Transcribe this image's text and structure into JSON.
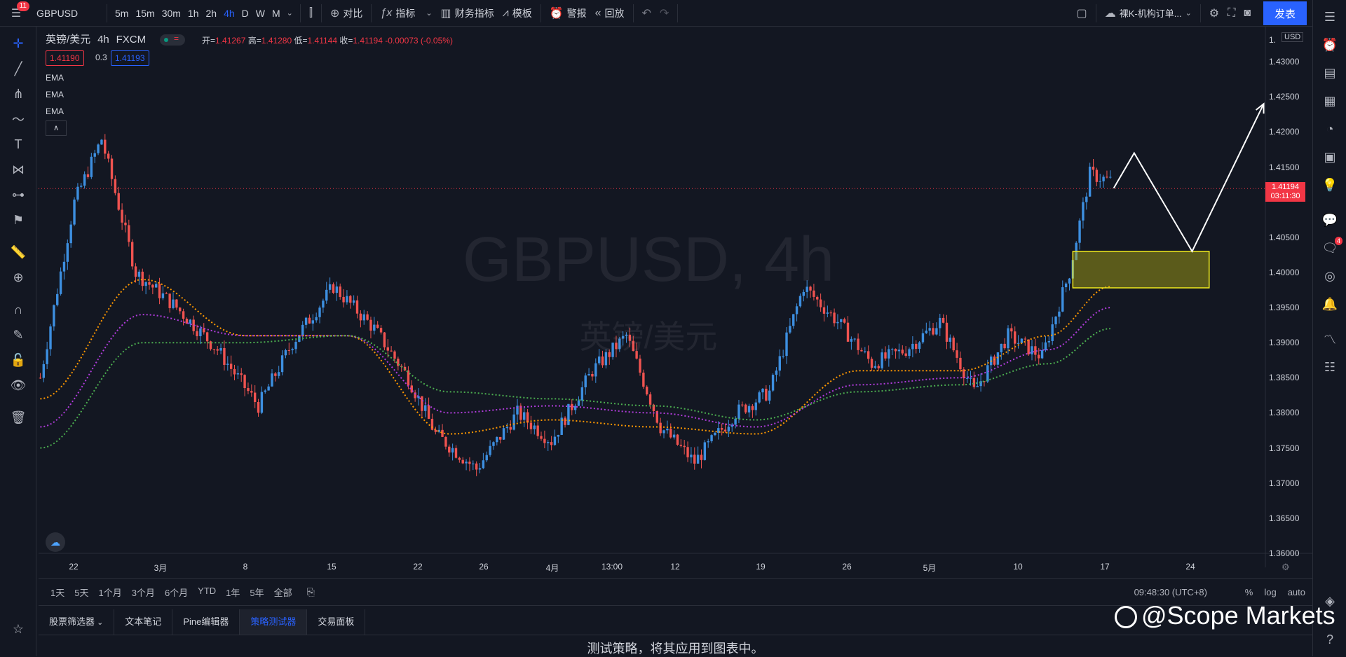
{
  "topbar": {
    "notif_count": "11",
    "symbol": "GBPUSD",
    "intervals": [
      "5m",
      "15m",
      "30m",
      "1h",
      "2h",
      "4h",
      "D",
      "W",
      "M"
    ],
    "active_interval": "4h",
    "compare": "对比",
    "indicators": "指标",
    "financials": "财务指标",
    "templates": "模板",
    "alerts": "警报",
    "replay": "回放",
    "layout_name": "裸K-机构订单...",
    "publish": "发表"
  },
  "legend": {
    "symbol": "英镑/美元",
    "interval": "4h",
    "broker": "FXCM",
    "open_label": "开=",
    "open": "1.41267",
    "high_label": "高=",
    "high": "1.41280",
    "low_label": "低=",
    "low": "1.41144",
    "close_label": "收=",
    "close": "1.41194",
    "change": "-0.00073 (-0.05%)",
    "sell_price": "1.41190",
    "spread": "0.3",
    "buy_price": "1.41193",
    "ema_labels": [
      "EMA",
      "EMA",
      "EMA"
    ]
  },
  "watermark": {
    "symbol": "GBPUSD, 4h",
    "name": "英镑/美元"
  },
  "price_scale": {
    "currency": "USD",
    "top_tick": "1.",
    "ticks": [
      "1.43000",
      "1.42500",
      "1.42000",
      "1.41500",
      "1.40500",
      "1.40000",
      "1.39500",
      "1.39000",
      "1.38500",
      "1.38000",
      "1.37500",
      "1.37000",
      "1.36500",
      "1.36000"
    ],
    "last_price": "1.41194",
    "countdown": "03:11:30"
  },
  "time_scale": {
    "ticks": [
      "22",
      "3月",
      "8",
      "15",
      "22",
      "26",
      "4月",
      "13:00",
      "12",
      "19",
      "26",
      "5月",
      "10",
      "17",
      "24"
    ]
  },
  "timeframes": [
    "1天",
    "5天",
    "1个月",
    "3个月",
    "6个月",
    "YTD",
    "1年",
    "5年",
    "全部"
  ],
  "clock": "09:48:30 (UTC+8)",
  "scale_options": [
    "%",
    "log",
    "auto"
  ],
  "bottom_tabs": [
    "股票筛选器",
    "文本笔记",
    "Pine编辑器",
    "策略测试器",
    "交易面板"
  ],
  "active_bottom_tab": "策略测试器",
  "bottom_message": "测试策略，将其应用到图表中。",
  "brand": "@Scope Markets",
  "right_badge": "4",
  "colors": {
    "up": "#3d8fe0",
    "down": "#ef5350",
    "ema_fast": "#ff9800",
    "ema_mid": "#b03cdb",
    "ema_slow": "#4caf50",
    "zone": "#c9c21a",
    "accent": "#2962ff",
    "bg": "#131722"
  },
  "chart_data": {
    "type": "candlestick",
    "symbol": "GBPUSD",
    "interval": "4h",
    "ylim": [
      1.36,
      1.435
    ],
    "last_price": 1.41194,
    "path_anchors": [
      [
        0,
        1.385
      ],
      [
        10,
        1.41
      ],
      [
        18,
        1.419
      ],
      [
        28,
        1.4
      ],
      [
        40,
        1.395
      ],
      [
        52,
        1.389
      ],
      [
        64,
        1.381
      ],
      [
        74,
        1.39
      ],
      [
        86,
        1.398
      ],
      [
        98,
        1.392
      ],
      [
        108,
        1.385
      ],
      [
        116,
        1.377
      ],
      [
        128,
        1.372
      ],
      [
        140,
        1.38
      ],
      [
        150,
        1.376
      ],
      [
        162,
        1.386
      ],
      [
        172,
        1.391
      ],
      [
        182,
        1.378
      ],
      [
        192,
        1.373
      ],
      [
        204,
        1.38
      ],
      [
        214,
        1.383
      ],
      [
        224,
        1.398
      ],
      [
        234,
        1.393
      ],
      [
        244,
        1.387
      ],
      [
        254,
        1.389
      ],
      [
        264,
        1.393
      ],
      [
        274,
        1.383
      ],
      [
        284,
        1.391
      ],
      [
        294,
        1.388
      ],
      [
        302,
        1.4
      ],
      [
        308,
        1.414
      ],
      [
        314,
        1.413
      ]
    ],
    "ema_series": [
      {
        "color": "ema_fast",
        "points": [
          [
            0,
            1.382
          ],
          [
            30,
            1.399
          ],
          [
            60,
            1.391
          ],
          [
            90,
            1.391
          ],
          [
            120,
            1.377
          ],
          [
            150,
            1.379
          ],
          [
            180,
            1.378
          ],
          [
            210,
            1.377
          ],
          [
            240,
            1.386
          ],
          [
            270,
            1.386
          ],
          [
            296,
            1.391
          ],
          [
            314,
            1.398
          ]
        ]
      },
      {
        "color": "ema_mid",
        "points": [
          [
            0,
            1.378
          ],
          [
            30,
            1.394
          ],
          [
            60,
            1.391
          ],
          [
            90,
            1.391
          ],
          [
            120,
            1.38
          ],
          [
            150,
            1.381
          ],
          [
            180,
            1.38
          ],
          [
            210,
            1.378
          ],
          [
            240,
            1.384
          ],
          [
            270,
            1.385
          ],
          [
            296,
            1.389
          ],
          [
            314,
            1.395
          ]
        ]
      },
      {
        "color": "ema_slow",
        "points": [
          [
            0,
            1.375
          ],
          [
            30,
            1.39
          ],
          [
            60,
            1.39
          ],
          [
            90,
            1.391
          ],
          [
            120,
            1.383
          ],
          [
            150,
            1.382
          ],
          [
            180,
            1.381
          ],
          [
            210,
            1.379
          ],
          [
            240,
            1.383
          ],
          [
            270,
            1.384
          ],
          [
            296,
            1.387
          ],
          [
            314,
            1.392
          ]
        ]
      }
    ],
    "demand_zone": {
      "price_top": 1.403,
      "price_bottom": 1.3978,
      "bar_start": 303,
      "bar_end": 343
    },
    "projection": [
      [
        315,
        1.412
      ],
      [
        321,
        1.417
      ],
      [
        338,
        1.403
      ],
      [
        359,
        1.424
      ]
    ]
  }
}
